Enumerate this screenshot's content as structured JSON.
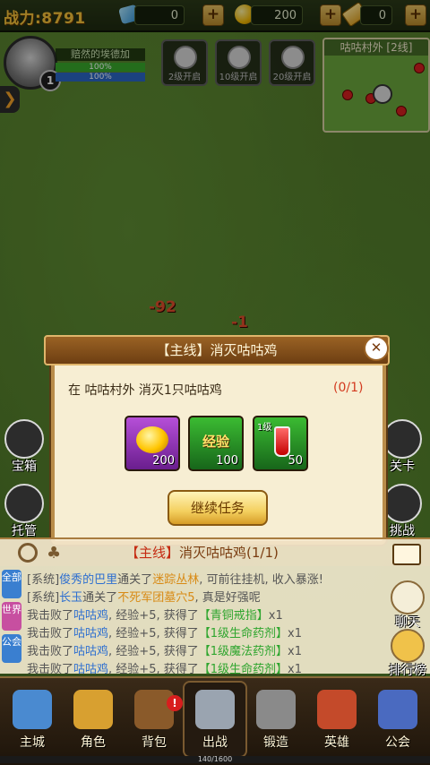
{
  "topbar": {
    "power_label": "战力:8791",
    "gems": "0",
    "gold": "200",
    "tickets": "0"
  },
  "player": {
    "name": "赔然的埃德加",
    "level": "1",
    "hp": "100%",
    "mp": "100%"
  },
  "locked": [
    {
      "label": "2级开启"
    },
    {
      "label": "10级开启"
    },
    {
      "label": "20级开启"
    }
  ],
  "minimap": {
    "title": "咕咕村外 [2线]"
  },
  "damage": [
    "-92",
    "-1"
  ],
  "side": {
    "left_top": "宝箱",
    "left_bottom": "托管",
    "right_top": "关卡",
    "right_bottom": "挑战"
  },
  "dialog": {
    "title": "【主线】消灭咕咕鸡",
    "desc": "在 咕咕村外 消灭1只咕咕鸡",
    "progress": "(0/1)",
    "rewards": [
      {
        "icon": "gold-coin",
        "value": "200"
      },
      {
        "label": "经验",
        "value": "100"
      },
      {
        "tag": "1级",
        "icon": "red-potion",
        "value": "50"
      }
    ],
    "continue": "继续任务",
    "close": "✕"
  },
  "quest_tracker": {
    "tag": "【主线】",
    "name": "消灭咕咕鸡",
    "count": "(1/1)"
  },
  "chat_tabs": [
    "全部",
    "世界",
    "公会"
  ],
  "chat": [
    {
      "p": "[系统]",
      "who": "俊秀的巴里",
      "m": "通关了",
      "place": "迷踪丛林",
      "tail": ", 可前往挂机, 收入暴涨!"
    },
    {
      "p": "[系统]",
      "who": "长玉",
      "m": "通关了",
      "place": "不死军团墓穴5",
      "tail": ", 真是好强呢"
    },
    {
      "p": "我击败了",
      "who": "咕咕鸡",
      "m": ", 经验+5, 获得了",
      "place": "【青铜戒指】",
      "tail": "x1"
    },
    {
      "p": "我击败了",
      "who": "咕咕鸡",
      "m": ", 经验+5, 获得了",
      "place": "【1级生命药剂】",
      "tail": "x1"
    },
    {
      "p": "我击败了",
      "who": "咕咕鸡",
      "m": ", 经验+5, 获得了",
      "place": "【1级魔法药剂】",
      "tail": "x1"
    },
    {
      "p": "我击败了",
      "who": "咕咕鸡",
      "m": ", 经验+5, 获得了",
      "place": "【1级生命药剂】",
      "tail": "x1"
    }
  ],
  "right_actions": {
    "chat": "聊天",
    "rank": "排行榜"
  },
  "nav": [
    {
      "label": "主城"
    },
    {
      "label": "角色"
    },
    {
      "label": "背包",
      "badge": "!"
    },
    {
      "label": "出战"
    },
    {
      "label": "锻造"
    },
    {
      "label": "英雄"
    },
    {
      "label": "公会"
    }
  ],
  "xp": "140/1600"
}
